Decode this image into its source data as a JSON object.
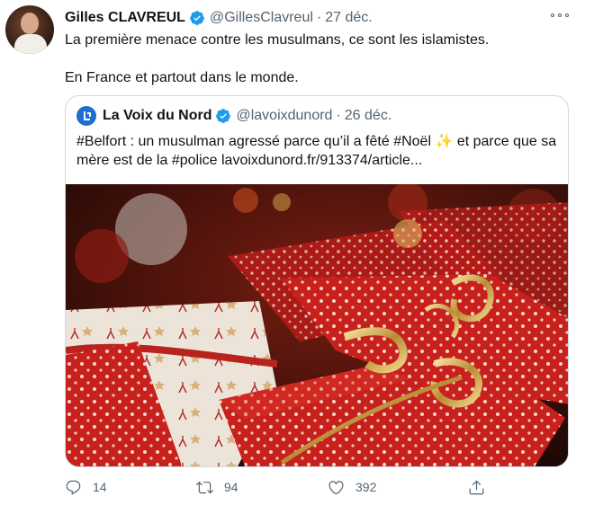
{
  "author": {
    "name": "Gilles CLAVREUL",
    "handle": "@GillesClavreul",
    "date": "27 déc."
  },
  "tweet": {
    "line1": "La première menace contre les musulmans, ce sont les islamistes.",
    "line2": "En France et partout dans le monde."
  },
  "quoted": {
    "name": "La Voix du Nord",
    "handle": "@lavoixdunord",
    "date": "26 déc.",
    "hashtag_belfort": "#Belfort",
    "text_a": " : un musulman agressé parce qu’il a fêté ",
    "hashtag_noel": "#Noël",
    "sparkle": "✨",
    "text_b": " et parce que sa mère est de la ",
    "hashtag_police": "#police",
    "link": "lavoixdunord.fr/913374/article..."
  },
  "actions": {
    "replies": "14",
    "retweets": "94",
    "likes": "392"
  },
  "colors": {
    "verified": "#1d9bf0",
    "secondary_text": "#536471",
    "border": "#cfd9de"
  }
}
